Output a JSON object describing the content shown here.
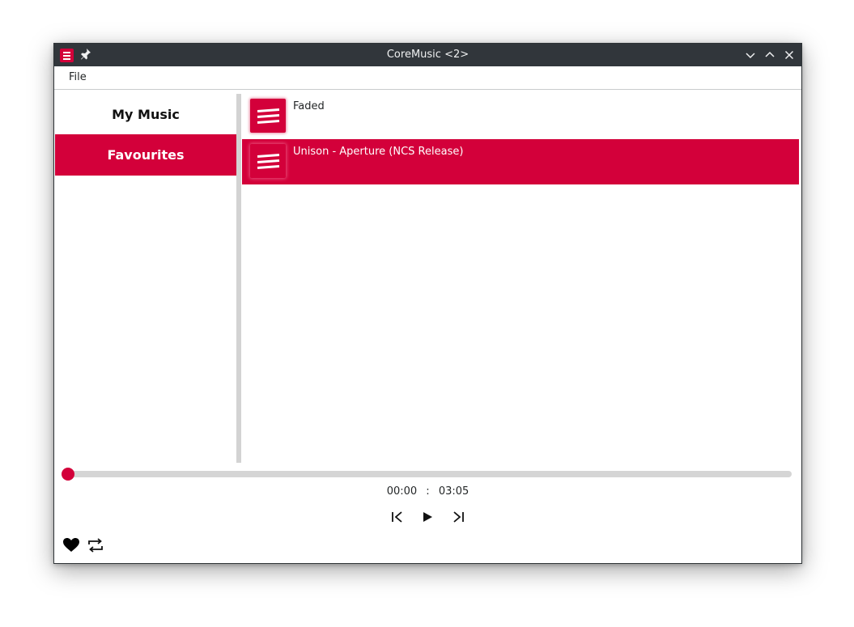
{
  "window": {
    "title": "CoreMusic <2>"
  },
  "menubar": {
    "file_label": "File"
  },
  "sidebar": {
    "items": [
      {
        "label": "My Music",
        "active": false
      },
      {
        "label": "Favourites",
        "active": true
      }
    ]
  },
  "tracks": [
    {
      "title": "Faded",
      "selected": false
    },
    {
      "title": "Unison - Aperture (NCS Release)",
      "selected": true
    }
  ],
  "player": {
    "progress": 0.0,
    "current_time": "00:00",
    "separator": ":",
    "total_time": "03:05"
  },
  "colors": {
    "accent": "#d3003a",
    "titlebar": "#31363b",
    "track_bg": "#d5d5d5"
  },
  "icons": {
    "app": "coremusic-app-icon",
    "pin": "pin-icon",
    "minimize": "chevron-down-icon",
    "maximize": "chevron-up-icon",
    "close": "close-icon",
    "previous": "skip-previous-icon",
    "play": "play-icon",
    "next": "skip-next-icon",
    "favourite": "heart-icon",
    "repeat": "repeat-icon"
  }
}
